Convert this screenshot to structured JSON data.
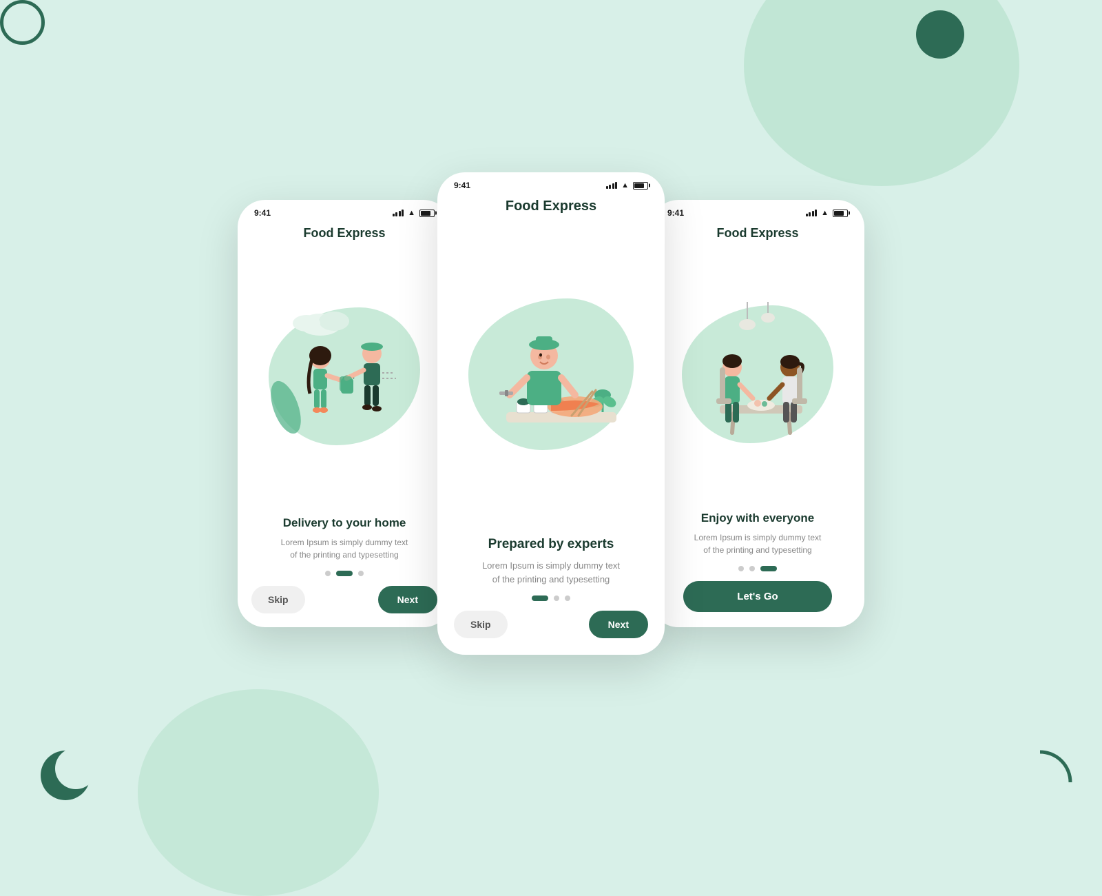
{
  "background": {
    "color": "#d8f0e8"
  },
  "phones": [
    {
      "id": "phone-left",
      "status": {
        "time": "9:41"
      },
      "title": "Food Express",
      "illustration": "delivery",
      "screen_title": "Delivery to  your home",
      "screen_desc": "Lorem Ipsum is simply dummy text\nof the printing and typesetting",
      "dots": [
        "inactive",
        "active",
        "inactive"
      ],
      "btn_skip": "Skip",
      "btn_next": "Next"
    },
    {
      "id": "phone-center",
      "status": {
        "time": "9:41"
      },
      "title": "Food Express",
      "illustration": "chef",
      "screen_title": "Prepared by experts",
      "screen_desc": "Lorem Ipsum is simply dummy text\nof the printing and typesetting",
      "dots": [
        "active",
        "inactive",
        "inactive"
      ],
      "btn_skip": "Skip",
      "btn_next": "Next"
    },
    {
      "id": "phone-right",
      "status": {
        "time": "9:41"
      },
      "title": "Food Express",
      "illustration": "dining",
      "screen_title": "Enjoy with everyone",
      "screen_desc": "Lorem Ipsum is simply dummy text\nof the printing and typesetting",
      "dots": [
        "inactive",
        "inactive",
        "active"
      ],
      "btn_letsgo": "Let's Go"
    }
  ]
}
